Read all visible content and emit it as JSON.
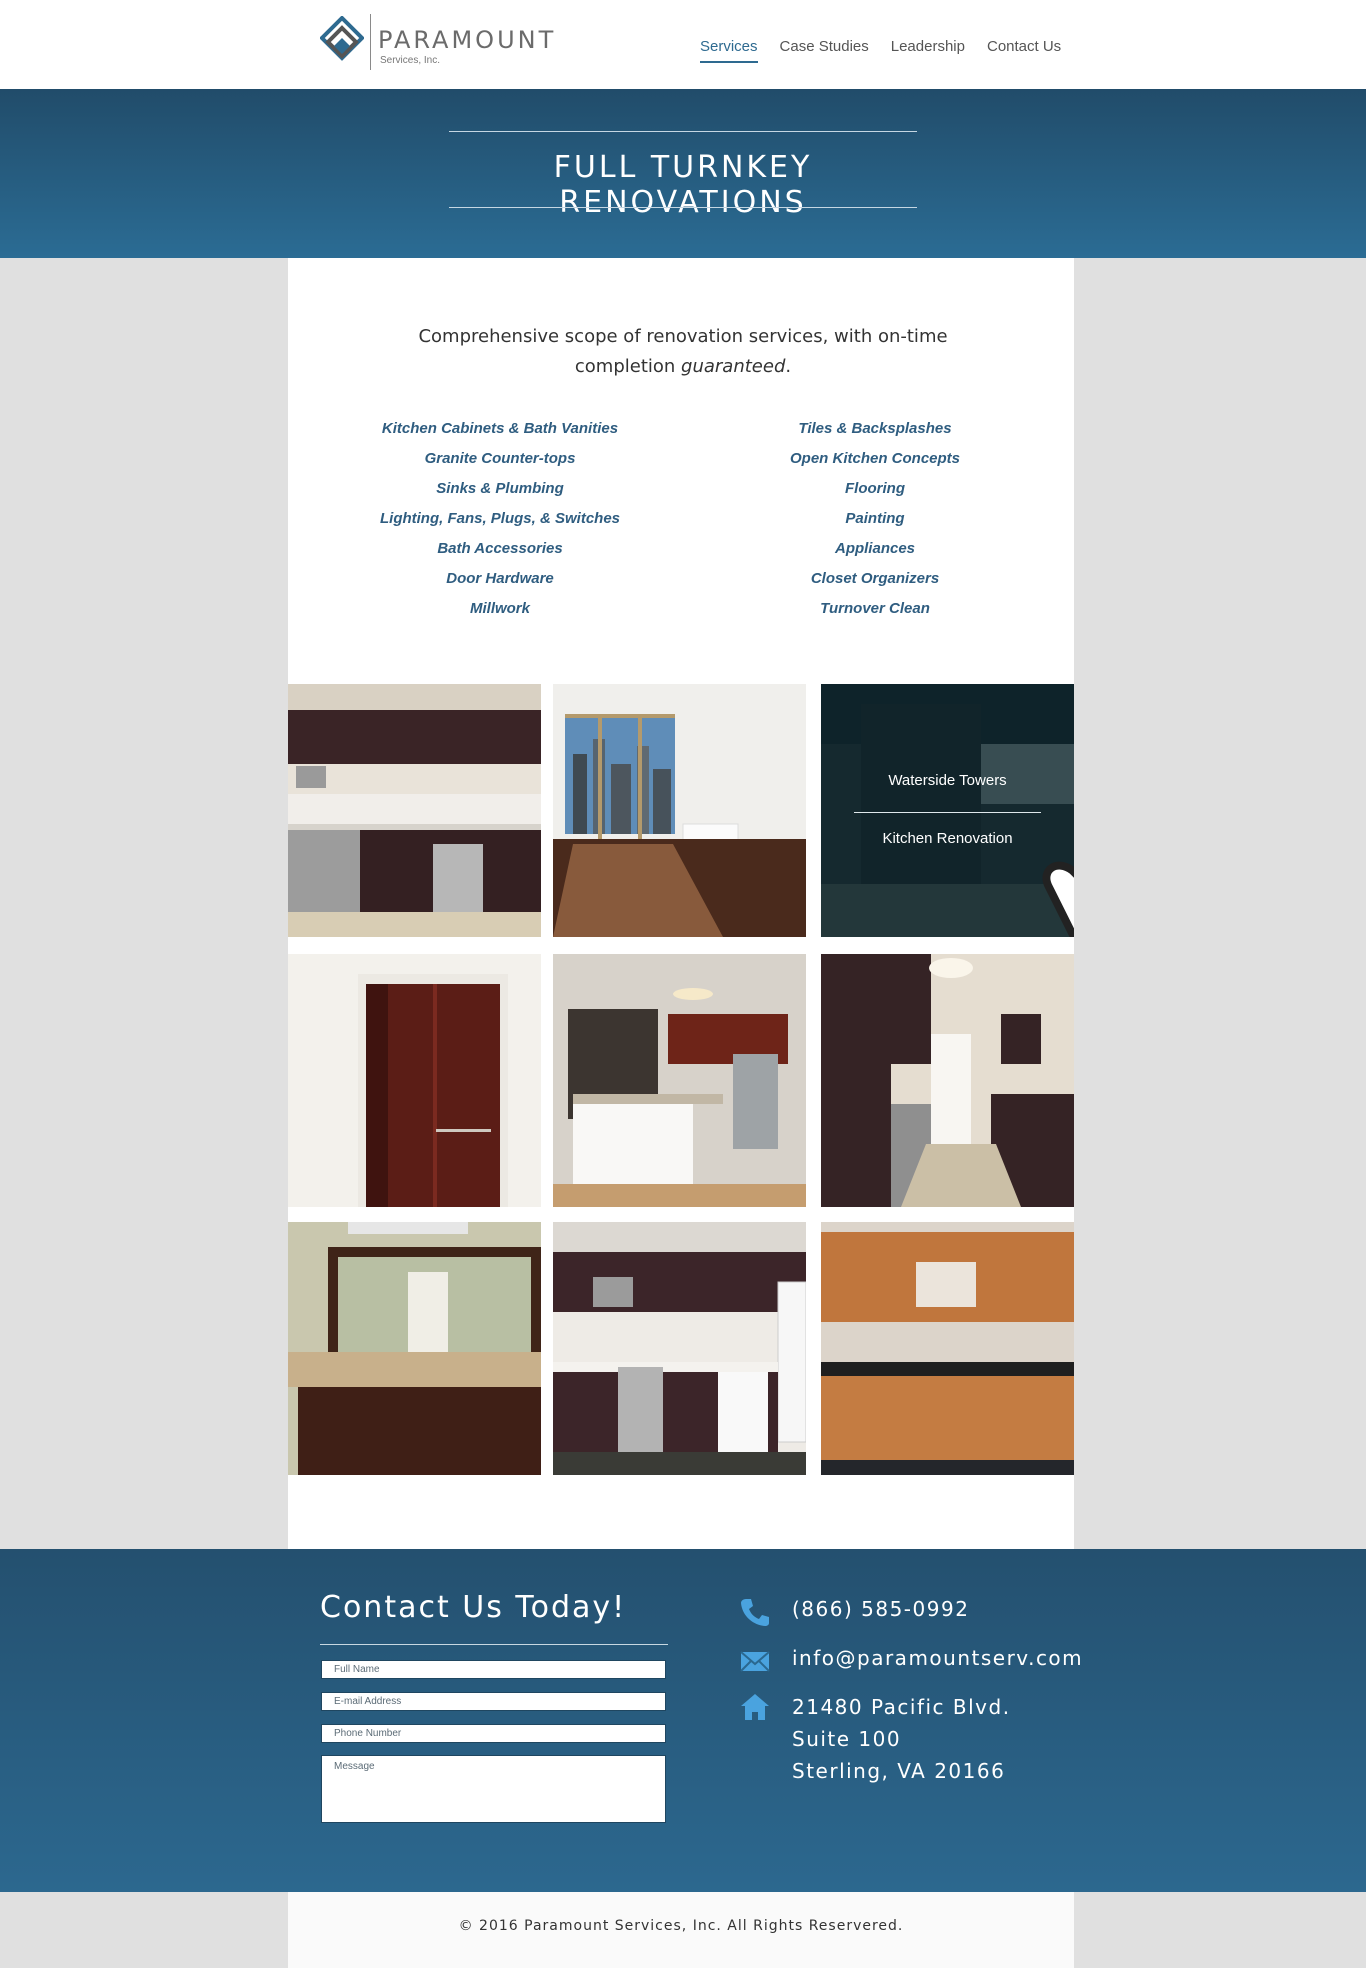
{
  "brand": {
    "name": "PARAMOUNT",
    "subtitle": "Services, Inc.",
    "color": "#2e6a90"
  },
  "nav": {
    "items": [
      {
        "label": "Services",
        "active": true
      },
      {
        "label": "Case Studies",
        "active": false
      },
      {
        "label": "Leadership",
        "active": false
      },
      {
        "label": "Contact Us",
        "active": false
      }
    ]
  },
  "hero": {
    "title": "FULL TURNKEY RENOVATIONS"
  },
  "intro": {
    "text": "Comprehensive scope of renovation services, with on-time completion ",
    "emphasis": "guaranteed",
    "suffix": "."
  },
  "services": {
    "left": [
      "Kitchen Cabinets & Bath Vanities",
      "Granite Counter-tops",
      "Sinks & Plumbing",
      "Lighting, Fans, Plugs, & Switches",
      "Bath Accessories",
      "Door Hardware",
      "Millwork"
    ],
    "right": [
      "Tiles & Backsplashes",
      "Open Kitchen Concepts",
      "Flooring",
      "Painting",
      "Appliances",
      "Closet Organizers",
      "Turnover Clean"
    ]
  },
  "gallery": {
    "hover_tile": {
      "title": "Waterside Towers",
      "subtitle": "Kitchen Renovation"
    },
    "images": [
      "kitchen-dark-cabinets",
      "living-room-city-view",
      "kitchen-dark-hovered",
      "closet-doors",
      "open-kitchen-island",
      "galley-kitchen",
      "bathroom-vanity",
      "kitchen-white-appliances",
      "kitchen-wood-cabinets"
    ]
  },
  "contact": {
    "title": "Contact Us Today!",
    "form": {
      "name_placeholder": "Full Name",
      "email_placeholder": "E-mail Address",
      "phone_placeholder": "Phone Number",
      "message_placeholder": "Message"
    },
    "phone": "(866) 585-0992",
    "email": "info@paramountserv.com",
    "address": [
      "21480 Pacific Blvd.",
      "Suite 100",
      "Sterling, VA 20166"
    ],
    "icons": [
      "phone-icon",
      "envelope-icon",
      "home-icon"
    ],
    "icon_color": "#4aa3df"
  },
  "footer": {
    "copyright": "© 2016 Paramount Services, Inc. All Rights Reservered."
  }
}
